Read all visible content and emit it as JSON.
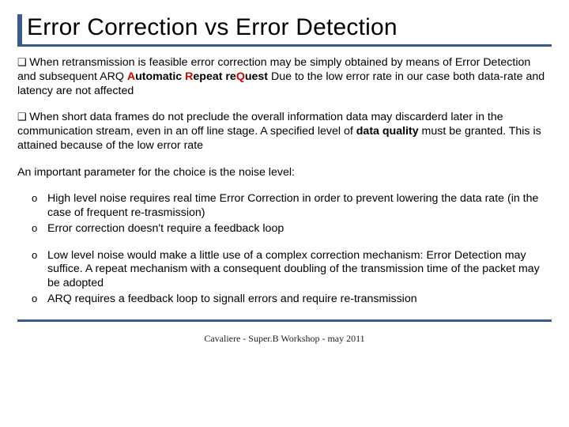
{
  "title": "Error Correction vs Error Detection",
  "para1_pre": "When retransmission is feasible error correction may be simply obtained by means of Error Detection and subsequent ARQ ",
  "arq_A": "A",
  "arq_auto": "utomatic ",
  "arq_R": "R",
  "arq_repeat": "epeat  re",
  "arq_Q": "Q",
  "arq_uest": "uest",
  "para1_post": " Due to the low error rate in our case both data-rate and latency are not affected",
  "para2_pre": "When short data frames do not preclude the overall information data may discarderd later in the communication stream, even in an off line stage. A specified level  of ",
  "para2_bold": "data quality",
  "para2_post": " must be granted. This is attained because of the low error rate",
  "para3": " An important parameter for the choice is the noise level:",
  "listA": {
    "i0": "High level noise requires real time Error Correction in order to prevent lowering the data rate (in the case of frequent re-trasmission)",
    "i1": "Error correction doesn't require a feedback loop"
  },
  "listB": {
    "i0": "Low level noise would make a little use of a complex correction mechanism: Error Detection may suffice. A repeat mechanism with a consequent doubling of the transmission time of the packet  may be adopted",
    "i1": "ARQ requires a feedback loop to signall errors and require re-transmission"
  },
  "footer": "Cavaliere - Super.B Workshop - may 2011"
}
